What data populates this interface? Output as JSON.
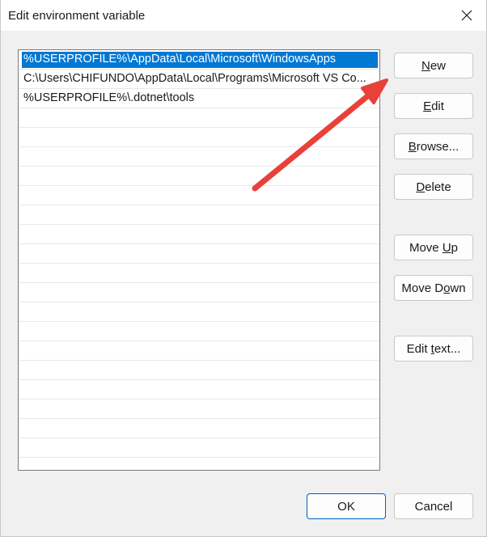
{
  "window": {
    "title": "Edit environment variable",
    "close_icon": "close-icon"
  },
  "list": {
    "items": [
      {
        "text": "%USERPROFILE%\\AppData\\Local\\Microsoft\\WindowsApps",
        "selected": true
      },
      {
        "text": "C:\\Users\\CHIFUNDO\\AppData\\Local\\Programs\\Microsoft VS Co...",
        "selected": false
      },
      {
        "text": "%USERPROFILE%\\.dotnet\\tools",
        "selected": false
      }
    ],
    "selection_color": "#0078d4"
  },
  "buttons": {
    "new": {
      "pre": "",
      "key": "N",
      "post": "ew"
    },
    "edit": {
      "pre": "",
      "key": "E",
      "post": "dit"
    },
    "browse": {
      "pre": "",
      "key": "B",
      "post": "rowse..."
    },
    "delete": {
      "pre": "",
      "key": "D",
      "post": "elete"
    },
    "move_up": {
      "pre": "Move ",
      "key": "U",
      "post": "p"
    },
    "move_down": {
      "pre": "Move D",
      "key": "o",
      "post": "wn"
    },
    "edit_text": {
      "pre": "Edit ",
      "key": "t",
      "post": "ext..."
    },
    "ok": "OK",
    "cancel": "Cancel"
  },
  "annotation": {
    "arrow_color": "#e8413a",
    "points_to": "new-button"
  }
}
